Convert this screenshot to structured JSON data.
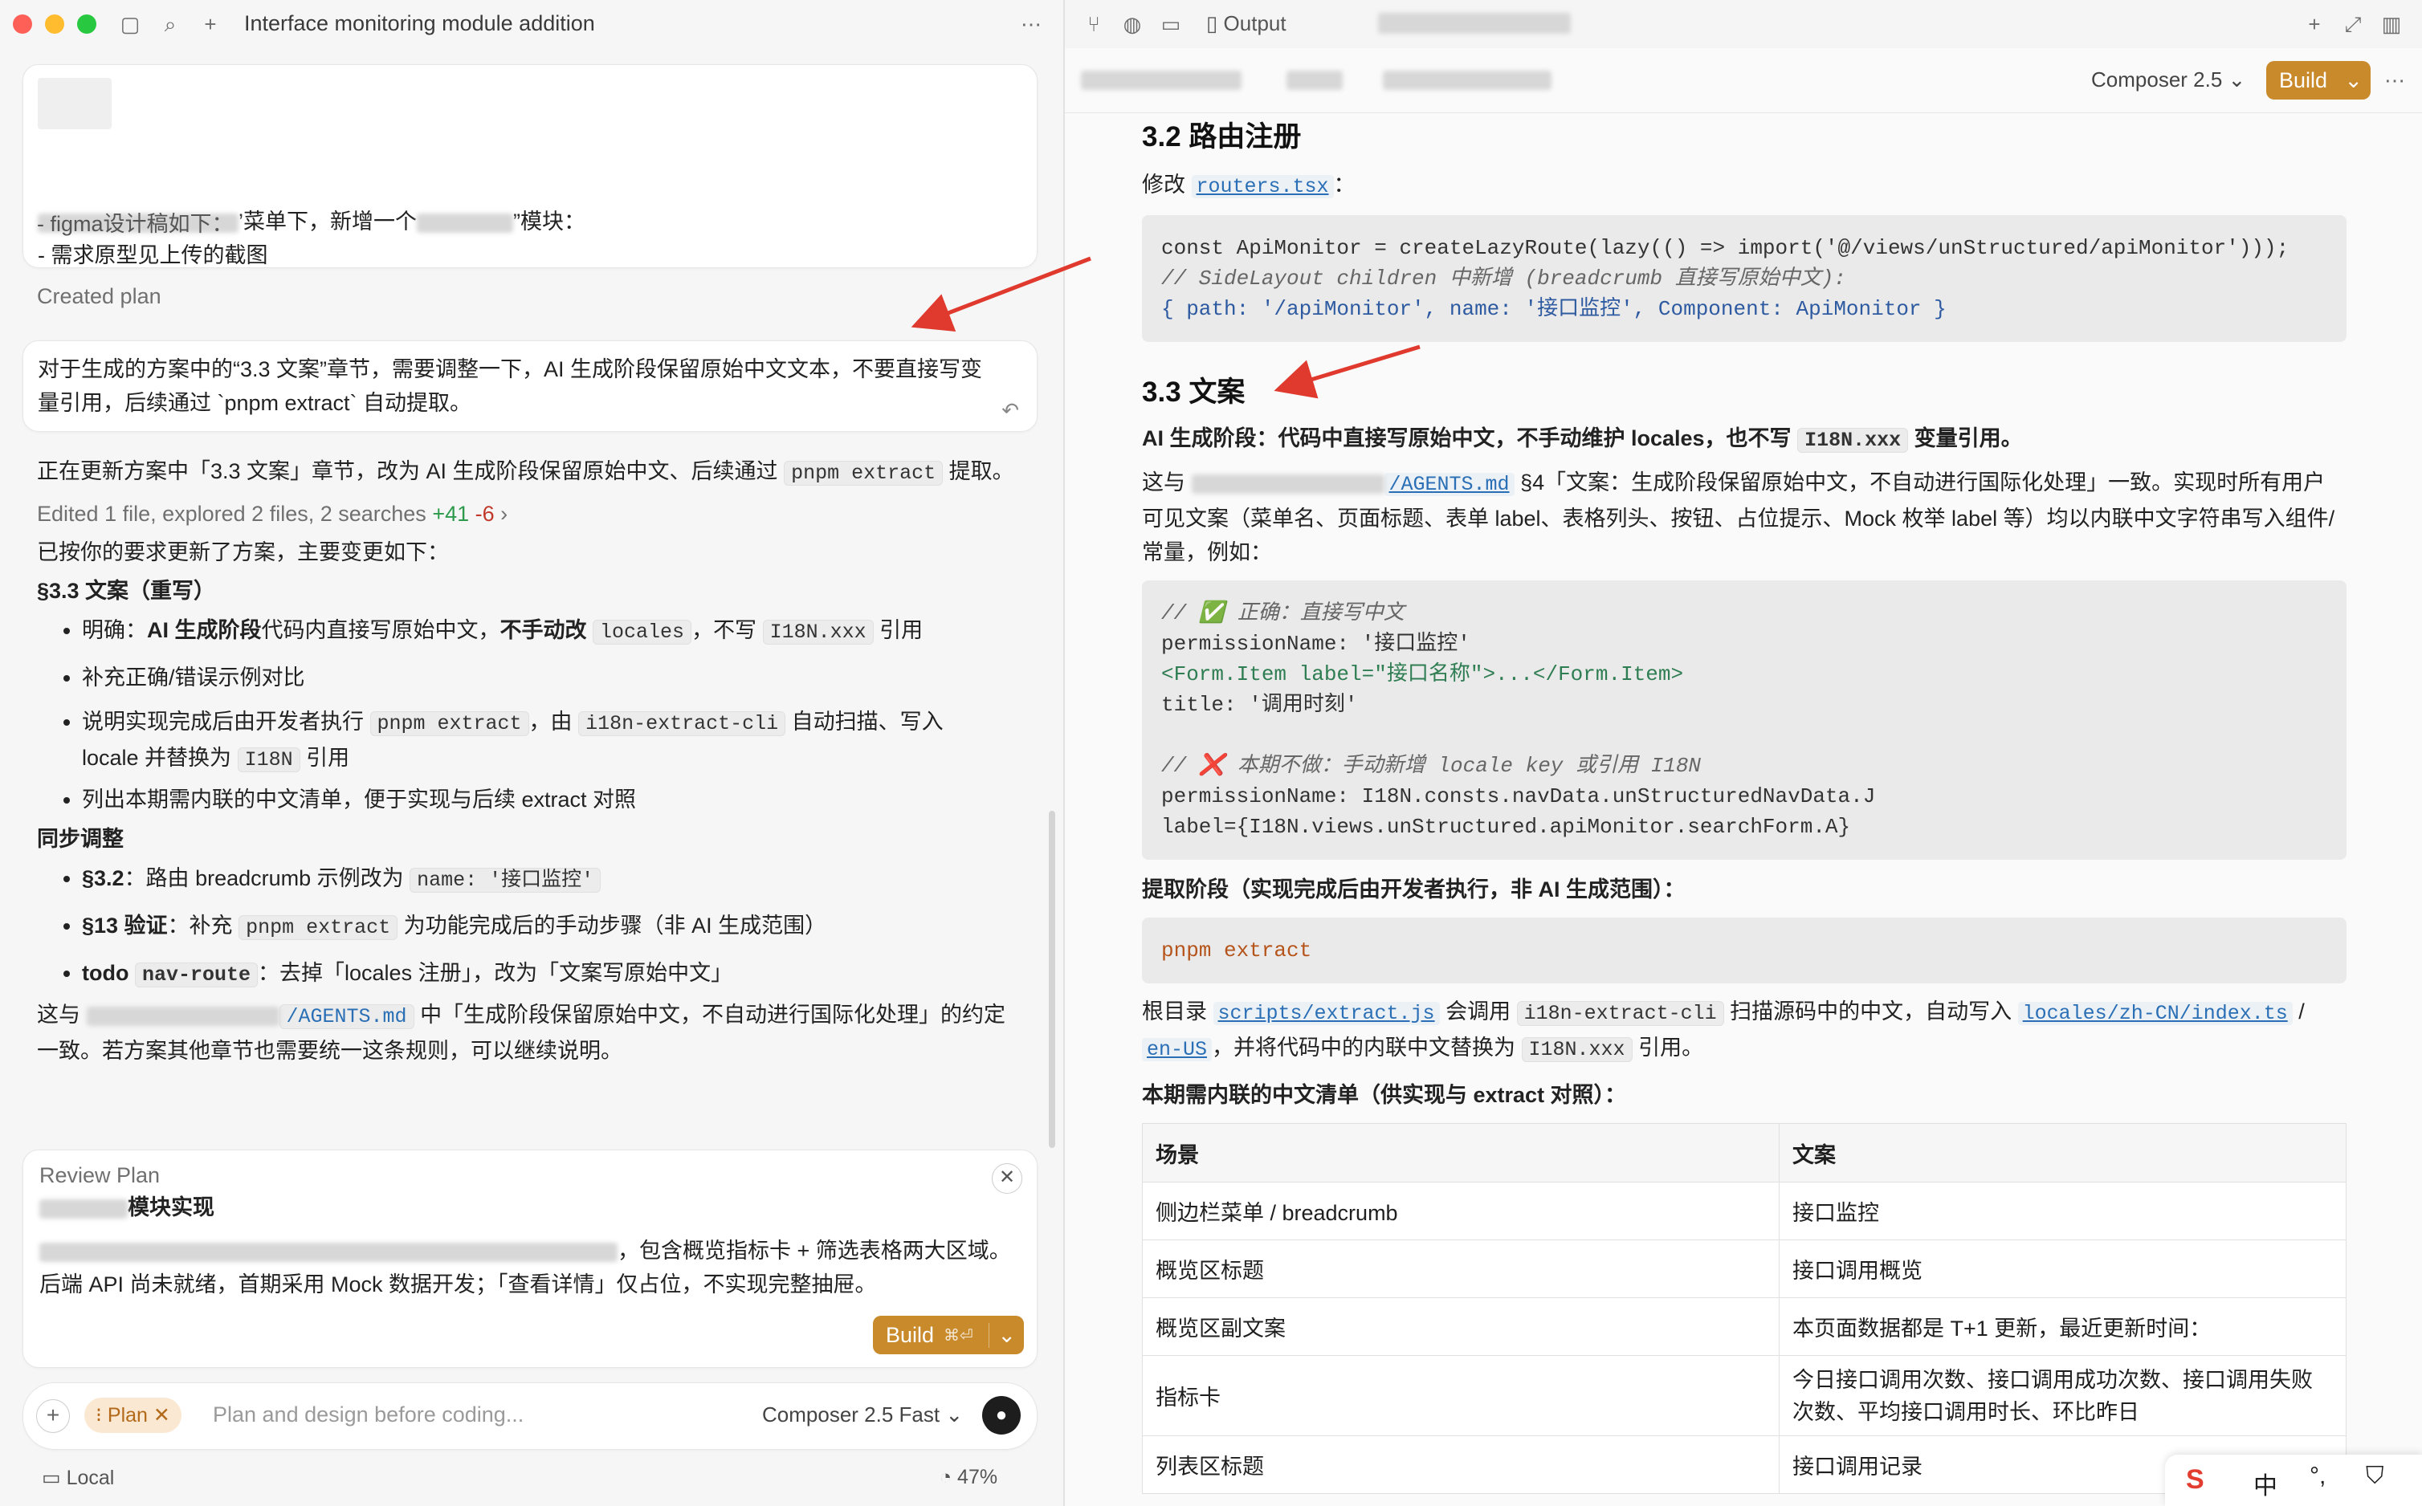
{
  "window": {
    "title": "Interface monitoring module addition"
  },
  "left": {
    "first_card": {
      "line1_mid": "’菜单下，新增一个",
      "line1_end": "”模块：",
      "line2": "- 需求原型见上传的截图",
      "line3": "- figma设计稿如下："
    },
    "created_plan": "Created plan",
    "user_msg": "对于生成的方案中的“3.3 文案”章节，需要调整一下，AI 生成阶段保留原始中文文本，不要直接写变量引用，后续通过 `pnpm extract` 自动提取。",
    "updating_text_1": "正在更新方案中「3.3 文案」章节，改为 AI 生成阶段保留原始中文、后续通过",
    "updating_code": "pnpm extract",
    "updating_text_2": "提取。",
    "edited_label": "Edited",
    "edited_detail": "1 file, explored 2 files, 2 searches",
    "edited_plus": "+41",
    "edited_minus": "-6",
    "updated_intro": "已按你的要求更新了方案，主要变更如下：",
    "sec_heading": "§3.3 文案（重写）",
    "b1_a": "明确：",
    "b1_b": "AI 生成阶段",
    "b1_c": "代码内直接写原始中文，",
    "b1_d": "不手动改",
    "b1_code1": "locales",
    "b1_e": "，不写",
    "b1_code2": "I18N.xxx",
    "b1_f": "引用",
    "b2": "补充正确/错误示例对比",
    "b3_a": "说明实现完成后由开发者执行",
    "b3_code1": "pnpm extract",
    "b3_b": "，由",
    "b3_code2": "i18n-extract-cli",
    "b3_c": "自动扫描、写入",
    "b3_d": "locale 并替换为",
    "b3_code3": "I18N",
    "b3_e": "引用",
    "b4": "列出本期需内联的中文清单，便于实现与后续 extract 对照",
    "sync_heading": "同步调整",
    "s1_a": "§3.2",
    "s1_b": "：路由 breadcrumb 示例改为",
    "s1_code": "name: '接口监控'",
    "s2_a": "§13 验证",
    "s2_b": "：补充",
    "s2_code": "pnpm extract",
    "s2_c": "为功能完成后的手动步骤（非 AI 生成范围）",
    "s3_a": "todo",
    "s3_code": "nav-route",
    "s3_b": "：去掉「locales 注册」，改为「文案写原始中文」",
    "closing_a": "这与",
    "closing_file": "/AGENTS.md",
    "closing_b": "中「生成阶段保留原始中文，不自动进行国际化处理」的约定一致。若方案其他章节也需要统一这条规则，可以继续说明。",
    "review": {
      "label": "Review Plan",
      "title_end": "模块实现",
      "desc_end": "，包含概览指标卡 + 筛选表格两大区域。后端 API 尚未就绪，首期采用 Mock 数据开发；「查看详情」仅占位，不实现完整抽屉。",
      "build": "Build",
      "shortcut": "⌘⏎"
    },
    "composer": {
      "mode": "Plan",
      "placeholder": "Plan and design before coding...",
      "model": "Composer 2.5 Fast"
    },
    "footer": {
      "local": "Local",
      "progress": "47%"
    }
  },
  "right": {
    "output_tab": "Output",
    "composer_model": "Composer 2.5",
    "build": "Build",
    "h32": "3.2 路由注册",
    "modify_a": "修改",
    "modify_file": "routers.tsx",
    "modify_b": "：",
    "code1_l1": "const ApiMonitor = createLazyRoute(lazy(() => import('@/views/unStructured/apiMonitor')));",
    "code1_l2": "// SideLayout children 中新增 (breadcrumb 直接写原始中文):",
    "code1_l3": "{ path: '/apiMonitor', name: '接口监控', Component: ApiMonitor }",
    "h33": "3.3 文案",
    "ai_stage_a": "AI 生成阶段：代码中直接写原始中文，不手动维护 locales，也不写",
    "ai_stage_code": "I18N.xxx",
    "ai_stage_b": "变量引用。",
    "para1_a": "这与",
    "para1_file": "/AGENTS.md",
    "para1_b": "§4「文案：生成阶段保留原始中文，不自动进行国际化处理」一致。实现时所有用户可见文案（菜单名、页面标题、表单 label、表格列头、按钮、占位提示、Mock 枚举 label 等）均以内联中文字符串写入组件/常量，例如：",
    "code2": [
      "// ✅ 正确：直接写中文",
      "permissionName: '接口监控'",
      "<Form.Item label=\"接口名称\">...</Form.Item>",
      "title: '调用时刻'",
      "",
      "// ❌ 本期不做：手动新增 locale key 或引用 I18N",
      "permissionName: I18N.consts.navData.unStructuredNavData.J",
      "label={I18N.views.unStructured.apiMonitor.searchForm.A}"
    ],
    "extract_heading": "提取阶段（实现完成后由开发者执行，非 AI 生成范围）：",
    "code3": "pnpm extract",
    "para2_a": "根目录",
    "para2_f1": "scripts/extract.js",
    "para2_b": "会调用",
    "para2_code": "i18n-extract-cli",
    "para2_c": "扫描源码中的中文，自动写入",
    "para2_f2": "locales/zh-CN/index.ts",
    "para2_d": "/",
    "para2_f3": "en-US",
    "para2_e": "，并将代码中的内联中文替换为",
    "para2_code2": "I18N.xxx",
    "para2_f": "引用。",
    "list_heading": "本期需内联的中文清单（供实现与 extract 对照）：",
    "table": {
      "headers": [
        "场景",
        "文案"
      ],
      "rows": [
        [
          "侧边栏菜单 / breadcrumb",
          "接口监控"
        ],
        [
          "概览区标题",
          "接口调用概览"
        ],
        [
          "概览区副文案",
          "本页面数据都是 T+1 更新，最近更新时间："
        ],
        [
          "指标卡",
          "今日接口调用次数、接口调用成功次数、接口调用失败次数、平均接口调用时长、环比昨日"
        ],
        [
          "列表区标题",
          "接口调用记录"
        ]
      ]
    },
    "ime": {
      "lang": "中"
    }
  }
}
